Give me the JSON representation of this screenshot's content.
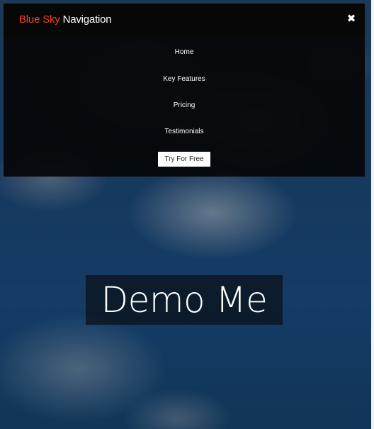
{
  "brand": {
    "accent_text": "Blue Sky",
    "main_text": "Navigation",
    "accent_color": "#ef4129"
  },
  "header": {
    "close_icon_glyph": "✖",
    "close_icon_name": "close-icon"
  },
  "menu": {
    "items": [
      {
        "label": "Home"
      },
      {
        "label": "Key Features"
      },
      {
        "label": "Pricing"
      },
      {
        "label": "Testimonials"
      }
    ],
    "cta_label": "Try For Free"
  },
  "hero": {
    "title": "Demo Me"
  }
}
